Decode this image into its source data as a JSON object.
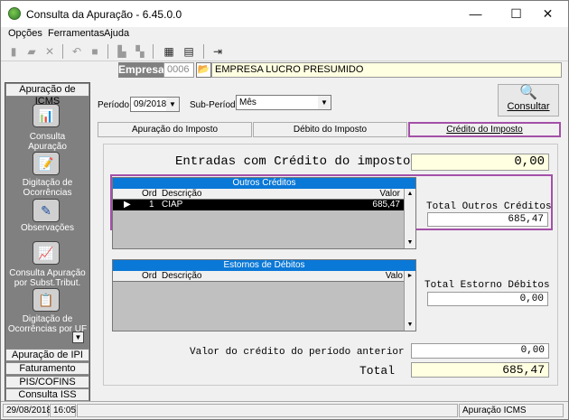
{
  "window": {
    "title": "Consulta da Apuração - 6.45.0.0",
    "minimize_glyph": "—",
    "maximize_glyph": "☐",
    "close_glyph": "✕"
  },
  "menu": [
    "Opções",
    "Ferramentas",
    "Ajuda"
  ],
  "toolbar": {
    "icons": [
      "new-icon",
      "open-icon",
      "delete-icon",
      "undo-icon",
      "stop-icon",
      "print-icon",
      "print-preview-icon",
      "calculator-icon",
      "sped-icon",
      "exit-icon"
    ]
  },
  "empresa": {
    "label": "Empresa",
    "code": "0006",
    "name": "EMPRESA LUCRO PRESUMIDO"
  },
  "sidebar": {
    "header": "Apuração de ICMS",
    "items": [
      {
        "label_line1": "Consulta",
        "label_line2": "Apuração",
        "icon": "chart-icon"
      },
      {
        "label_line1": "Digitação de",
        "label_line2": "Ocorrências",
        "icon": "document-icon"
      },
      {
        "label_line1": "Observações",
        "label_line2": "",
        "icon": "note-icon"
      },
      {
        "label_line1": "Consulta  Apuração",
        "label_line2": "por Subst.Tribut.",
        "icon": "st-chart-icon"
      },
      {
        "label_line1": "Digitação de",
        "label_line2": "Ocorrências por UF",
        "icon": "st-document-icon"
      }
    ],
    "categories": [
      "Apuração de IPI",
      "Faturamento",
      "PIS/COFINS",
      "Consulta ISS"
    ]
  },
  "filters": {
    "periodo_label": "Período",
    "periodo_value": "09/2018",
    "subperiodo_label": "Sub-Período",
    "subperiodo_value": "Mês",
    "consultar_label": "Consultar"
  },
  "tabs": [
    "Apuração do Imposto",
    "Débito do Imposto",
    "Crédito do Imposto"
  ],
  "credito": {
    "heading": "Entradas com Crédito do imposto",
    "heading_value": "0,00",
    "outros": {
      "title": "Outros Créditos",
      "columns": [
        "Ord",
        "Descrição",
        "Valor"
      ],
      "rows": [
        {
          "ord": "1",
          "descricao": "CIAP",
          "valor": "685,47"
        }
      ],
      "total_label": "Total Outros Créditos",
      "total_value": "685,47"
    },
    "estornos": {
      "title": "Estornos de Débitos",
      "columns": [
        "Ord",
        "Descrição",
        "Valo"
      ],
      "total_label": "Total Estorno Débitos",
      "total_value": "0,00"
    },
    "anterior_label": "Valor do crédito do período anterior",
    "anterior_value": "0,00",
    "total_label": "Total",
    "total_value": "685,47"
  },
  "status": {
    "date": "29/08/2018",
    "time": "16:05",
    "module": "Apuração ICMS"
  },
  "colors": {
    "accent": "#a450a8",
    "grid_title": "#0a78d7",
    "yellow_field": "#ffffe1"
  }
}
